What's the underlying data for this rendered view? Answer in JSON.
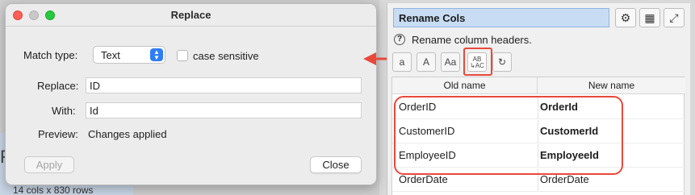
{
  "background": {
    "stats_text": "14 cols x 830 rows",
    "glyph": "F"
  },
  "dialog": {
    "title": "Replace",
    "match_type_label": "Match type:",
    "match_type_value": "Text",
    "case_sensitive_label": "case sensitive",
    "replace_label": "Replace:",
    "replace_value": "ID",
    "with_label": "With:",
    "with_value": "Id",
    "preview_label": "Preview:",
    "preview_value": "Changes applied",
    "apply_label": "Apply",
    "close_label": "Close"
  },
  "panel": {
    "title": "Rename Cols",
    "help_text": "Rename column headers.",
    "toolbar": [
      "a",
      "A",
      "Aa",
      "AB→AC",
      "↻"
    ],
    "columns": [
      "Old name",
      "New name"
    ],
    "rows": [
      {
        "old": "OrderID",
        "new": "OrderId"
      },
      {
        "old": "CustomerID",
        "new": "CustomerId"
      },
      {
        "old": "EmployeeID",
        "new": "EmployeeId"
      },
      {
        "old": "OrderDate",
        "new": "OrderDate"
      }
    ]
  },
  "colors": {
    "accent": "#2d7df6",
    "highlight": "#e8493b",
    "title_field": "#c8ddf4"
  }
}
